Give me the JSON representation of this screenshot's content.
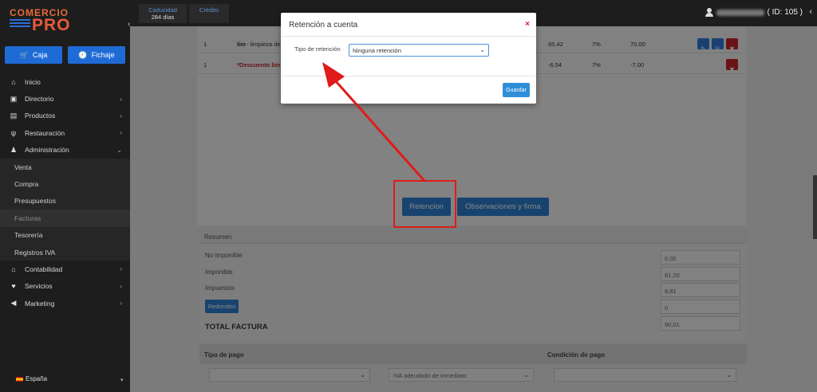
{
  "brand": {
    "line1": "COMERCIO",
    "line2": "PRO"
  },
  "sidebar": {
    "buttons": [
      {
        "label": "Caja"
      },
      {
        "label": "Fichaje"
      }
    ],
    "items": [
      {
        "label": "Inicio"
      },
      {
        "label": "Directorio"
      },
      {
        "label": "Productos"
      },
      {
        "label": "Restauración"
      },
      {
        "label": "Administración"
      }
    ],
    "sub_items": [
      {
        "label": "Venta"
      },
      {
        "label": "Compra"
      },
      {
        "label": "Presupuestos"
      },
      {
        "label": "Facturas"
      },
      {
        "label": "Tesorería"
      },
      {
        "label": "Registros IVA"
      }
    ],
    "items_after": [
      {
        "label": "Contabilidad"
      },
      {
        "label": "Servicios"
      },
      {
        "label": "Marketing"
      }
    ],
    "language": "España"
  },
  "topbar": {
    "cards": [
      {
        "title": "Caducidad",
        "value": "284 días"
      },
      {
        "title": "Crédito",
        "value": ""
      }
    ],
    "user_id": "( ID: 105 )"
  },
  "table": {
    "rows": [
      {
        "qty": "1",
        "desc_bold": "lim",
        "desc": " - limpieza de",
        "price": "65.42",
        "tax": "7%",
        "total": "70.00"
      },
      {
        "qty": "1",
        "desc_bold": "*Descuento lim",
        "desc": "",
        "price": "-6.54",
        "tax": "7%",
        "total": "-7.00"
      }
    ]
  },
  "actions": {
    "retencion": "Retencion",
    "observaciones": "Observaciones y firma"
  },
  "summary": {
    "title": "Resumen",
    "rows": [
      {
        "label": "No imponible",
        "value": "0,00"
      },
      {
        "label": "Imponible",
        "value": "81,20"
      },
      {
        "label": "Impuestos",
        "value": "8,81"
      }
    ],
    "redondeo_label": "Redondeo",
    "redondeo_value": "0",
    "total_label": "TOTAL FACTURA",
    "total_value": "90,01"
  },
  "payment": {
    "tipo_label": "Tipo de pago",
    "condicion_label": "Condición de pago",
    "iva_option": "IVA adeudado de inmediato"
  },
  "modal": {
    "title": "Retención a cuenta",
    "close": "×",
    "field_label": "Tipo de retención",
    "field_value": "Ninguna retención",
    "save": "Guardar"
  },
  "colors": {
    "accent": "#2f7fd0",
    "danger": "#c9252c",
    "highlight": "#e01b1b"
  }
}
